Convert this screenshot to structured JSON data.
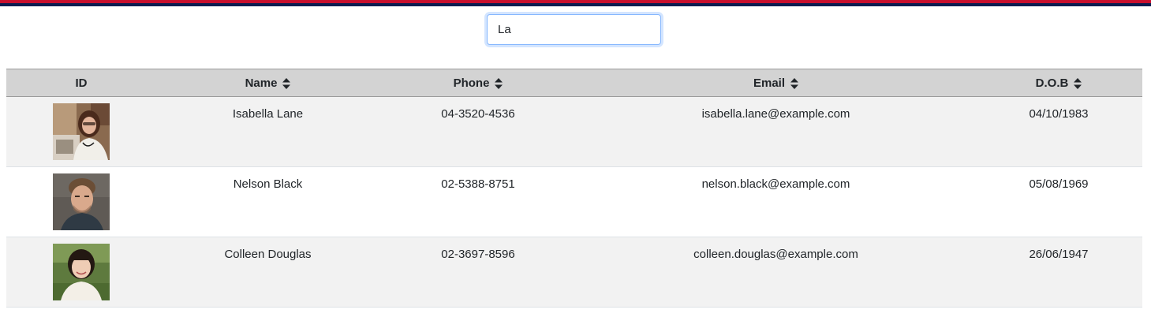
{
  "search": {
    "value": "La",
    "placeholder": ""
  },
  "table": {
    "headers": {
      "id": "ID",
      "name": "Name",
      "phone": "Phone",
      "email": "Email",
      "dob": "D.O.B"
    },
    "rows": [
      {
        "name": "Isabella Lane",
        "phone": "04-3520-4536",
        "email": "isabella.lane@example.com",
        "dob": "04/10/1983"
      },
      {
        "name": "Nelson Black",
        "phone": "02-5388-8751",
        "email": "nelson.black@example.com",
        "dob": "05/08/1969"
      },
      {
        "name": "Colleen Douglas",
        "phone": "02-3697-8596",
        "email": "colleen.douglas@example.com",
        "dob": "26/06/1947"
      }
    ]
  },
  "colors": {
    "top_bar_red": "#c8102e",
    "top_bar_navy": "#0b1d51",
    "header_bg": "#d3d3d3",
    "row_alt_bg": "#f2f2f2"
  },
  "icons": {
    "sort": "sort-icon"
  }
}
